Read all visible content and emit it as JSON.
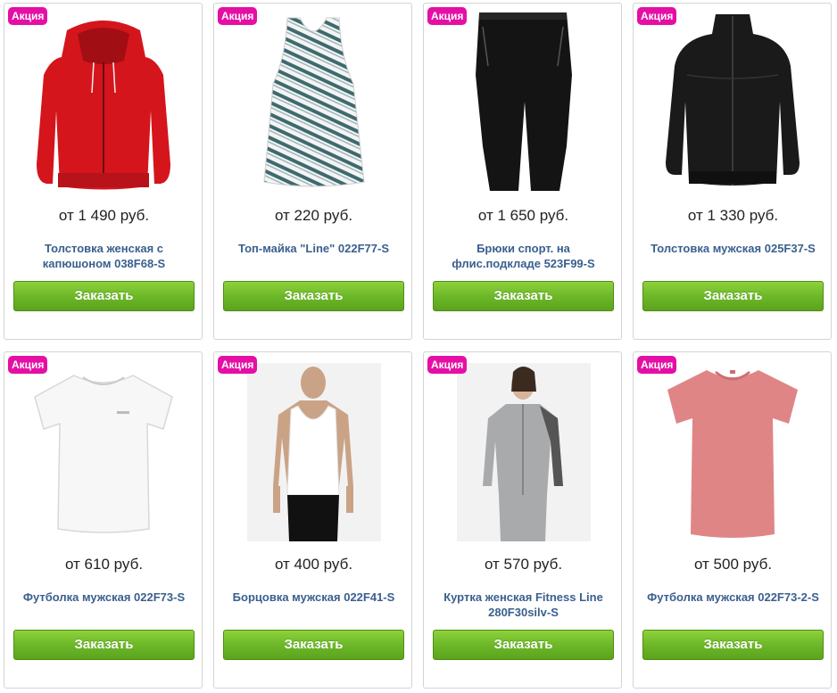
{
  "badge_label": "Акция",
  "order_label": "Заказать",
  "colors": {
    "badge": "#e50fa5",
    "button": "#6db82a",
    "product_link": "#3a5f8e"
  },
  "products": [
    {
      "price": "от 1 490 руб.",
      "name": "Толстовка женская с капюшоном 038F68-S",
      "image": "red-hoodie-icon"
    },
    {
      "price": "от 220 руб.",
      "name": "Топ-майка \"Line\" 022F77-S",
      "image": "striped-tank-top-icon"
    },
    {
      "price": "от 1 650 руб.",
      "name": "Брюки спорт. на флис.подкладе 523F99-S",
      "image": "black-pants-icon"
    },
    {
      "price": "от 1 330 руб.",
      "name": "Толстовка мужская 025F37-S",
      "image": "black-jacket-icon"
    },
    {
      "price": "от 610 руб.",
      "name": "Футболка мужская 022F73-S",
      "image": "white-tshirt-icon"
    },
    {
      "price": "от 400 руб.",
      "name": "Борцовка мужская 022F41-S",
      "image": "man-in-tank-top-icon"
    },
    {
      "price": "от 570 руб.",
      "name": "Куртка женская Fitness Line 280F30silv-S",
      "image": "woman-in-grey-jacket-icon"
    },
    {
      "price": "от 500 руб.",
      "name": "Футболка мужская 022F73-2-S",
      "image": "pink-tshirt-icon"
    }
  ]
}
